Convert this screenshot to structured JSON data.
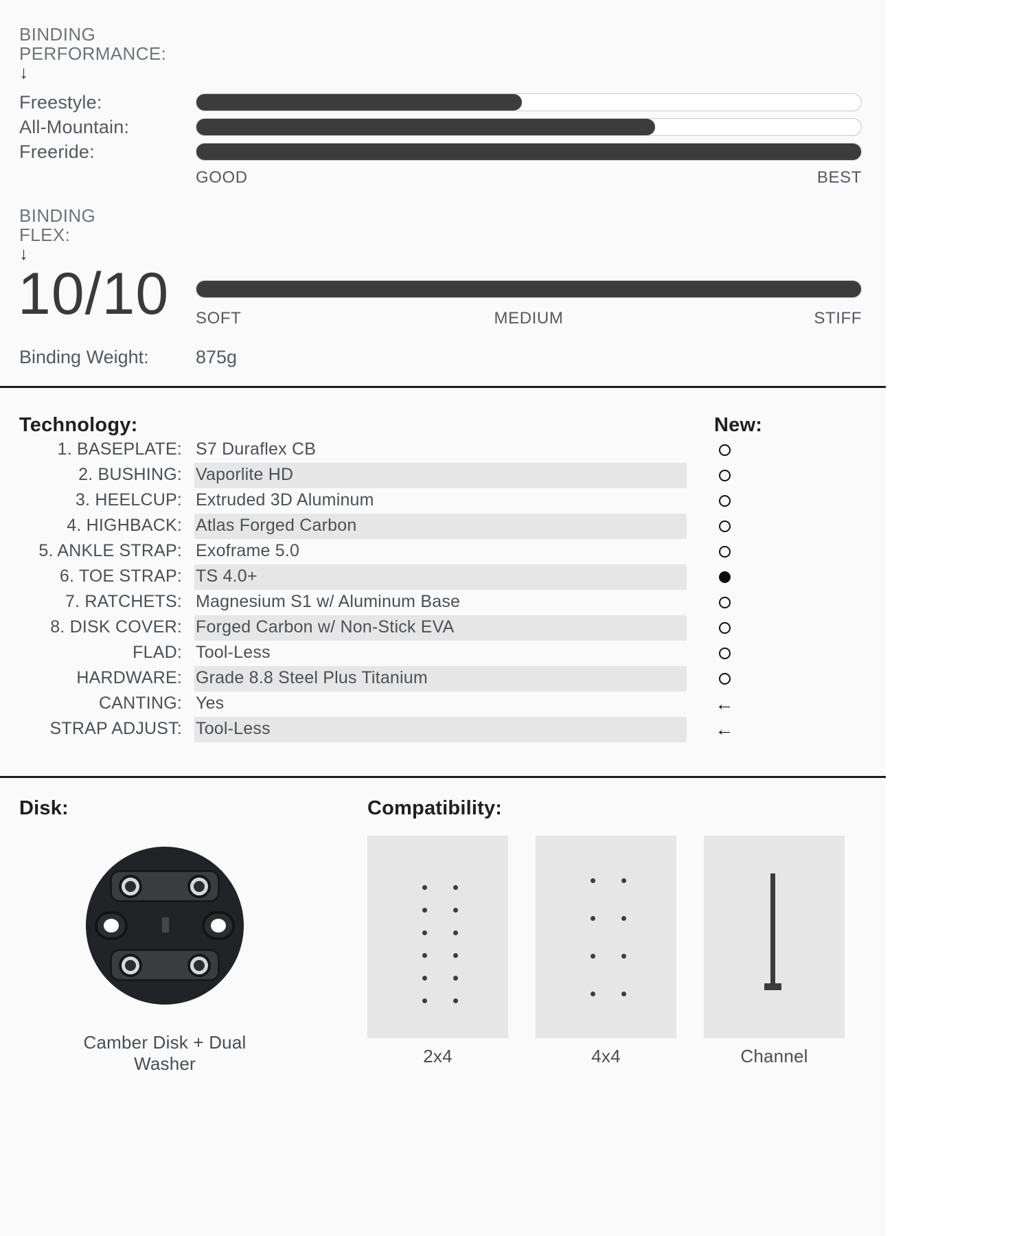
{
  "performance": {
    "heading": "BINDING\nPERFORMANCE:",
    "arrow": "↓",
    "rows": [
      {
        "label": "Freestyle:",
        "value": 49
      },
      {
        "label": "All-Mountain:",
        "value": 69
      },
      {
        "label": "Freeride:",
        "value": 100
      }
    ],
    "scale_left": "GOOD",
    "scale_right": "BEST"
  },
  "flex": {
    "heading": "BINDING\nFLEX:",
    "arrow": "↓",
    "rating": "10/10",
    "value": 100,
    "scale_left": "SOFT",
    "scale_mid": "MEDIUM",
    "scale_right": "STIFF"
  },
  "weight": {
    "label": "Binding Weight:",
    "value": "875g"
  },
  "technology": {
    "title": "Technology:",
    "new_title": "New:",
    "rows": [
      {
        "key": "1. BASEPLATE:",
        "value": "S7 Duraflex CB",
        "mark": "ring"
      },
      {
        "key": "2. BUSHING:",
        "value": "Vaporlite HD",
        "mark": "ring"
      },
      {
        "key": "3. HEELCUP:",
        "value": "Extruded 3D Aluminum",
        "mark": "ring"
      },
      {
        "key": "4. HIGHBACK:",
        "value": "Atlas Forged Carbon",
        "mark": "ring"
      },
      {
        "key": "5. ANKLE STRAP:",
        "value": "Exoframe 5.0",
        "mark": "ring"
      },
      {
        "key": "6. TOE STRAP:",
        "value": "TS 4.0+",
        "mark": "ring-filled"
      },
      {
        "key": "7. RATCHETS:",
        "value": "Magnesium S1 w/ Aluminum Base",
        "mark": "ring"
      },
      {
        "key": "8. DISK COVER:",
        "value": "Forged Carbon w/ Non-Stick EVA",
        "mark": "ring"
      },
      {
        "key": "FLAD:",
        "value": "Tool-Less",
        "mark": "ring"
      },
      {
        "key": "HARDWARE:",
        "value": "Grade 8.8 Steel Plus Titanium",
        "mark": "ring"
      },
      {
        "key": "CANTING:",
        "value": "Yes",
        "mark": "arrow"
      },
      {
        "key": "STRAP ADJUST:",
        "value": "Tool-Less",
        "mark": "arrow"
      }
    ],
    "arrow_glyph": "←"
  },
  "disk": {
    "title": "Disk:",
    "caption": "Camber Disk + Dual Washer"
  },
  "compatibility": {
    "title": "Compatibility:",
    "items": [
      {
        "label": "2x4",
        "type": "dots-2x4"
      },
      {
        "label": "4x4",
        "type": "dots-4x4"
      },
      {
        "label": "Channel",
        "type": "channel"
      }
    ]
  }
}
